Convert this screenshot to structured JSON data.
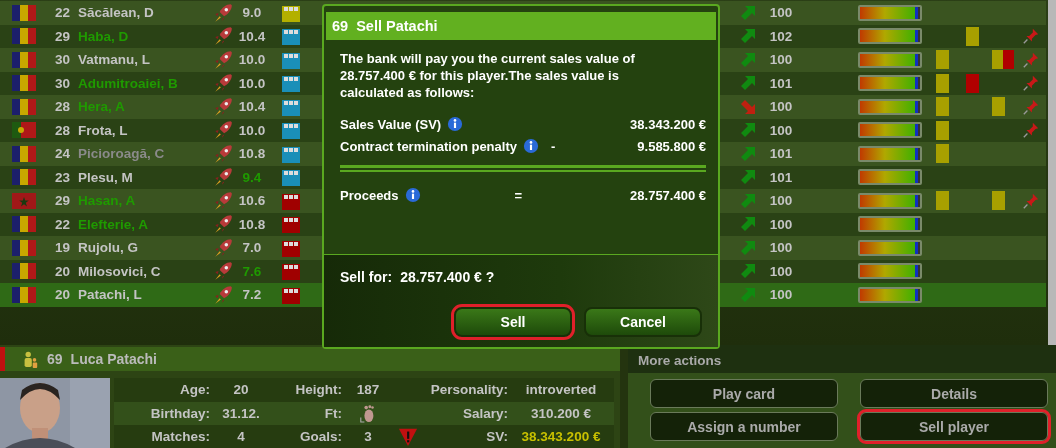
{
  "squad": {
    "rows": [
      {
        "flag": {
          "kind": "tricolor"
        },
        "number": "22",
        "name": "Săcălean, D",
        "in_lineup": false,
        "inactive": false,
        "rating": "9.0",
        "rating_good": false,
        "color": "#b3b000",
        "rising": true,
        "value": "100",
        "level": 0.97,
        "cards_1": [],
        "cards_2": [],
        "cards_3": [],
        "pinned": false,
        "selected": false
      },
      {
        "flag": {
          "kind": "tricolor"
        },
        "number": "29",
        "name": "Haba, D",
        "in_lineup": true,
        "inactive": false,
        "rating": "10.4",
        "rating_good": false,
        "color": "#1a8fb8",
        "rising": true,
        "value": "102",
        "level": 0.97,
        "cards_1": [],
        "cards_2": [
          {
            "color": "#a8a000"
          }
        ],
        "cards_3": [],
        "pinned": true,
        "selected": false
      },
      {
        "flag": {
          "kind": "tricolor"
        },
        "number": "30",
        "name": "Vatmanu, L",
        "in_lineup": false,
        "inactive": false,
        "rating": "10.0",
        "rating_good": false,
        "color": "#1a8fb8",
        "rising": true,
        "value": "100",
        "level": 0.97,
        "cards_1": [
          {
            "color": "#a8a000"
          }
        ],
        "cards_2": [],
        "cards_3": [
          {
            "color": "#a8a000"
          },
          {
            "color": "#b00000"
          }
        ],
        "pinned": true,
        "selected": false
      },
      {
        "flag": {
          "kind": "tricolor"
        },
        "number": "30",
        "name": "Adumitroaiei, B",
        "in_lineup": true,
        "inactive": false,
        "rating": "10.0",
        "rating_good": false,
        "color": "#1a8fb8",
        "rising": true,
        "value": "101",
        "level": 0.97,
        "cards_1": [
          {
            "color": "#a8a000"
          }
        ],
        "cards_2": [
          {
            "color": "#b00000"
          }
        ],
        "cards_3": [],
        "pinned": true,
        "selected": false
      },
      {
        "flag": {
          "kind": "tricolor"
        },
        "number": "28",
        "name": "Hera, A",
        "in_lineup": true,
        "inactive": false,
        "rating": "10.4",
        "rating_good": false,
        "color": "#1a8fb8",
        "rising": false,
        "value": "100",
        "level": 0.97,
        "cards_1": [
          {
            "color": "#a8a000"
          }
        ],
        "cards_2": [],
        "cards_3": [
          {
            "color": "#a8a000"
          }
        ],
        "pinned": true,
        "selected": false
      },
      {
        "flag": {
          "kind": "split"
        },
        "number": "28",
        "name": "Frota, L",
        "in_lineup": false,
        "inactive": false,
        "rating": "10.0",
        "rating_good": false,
        "color": "#1a8fb8",
        "rising": true,
        "value": "100",
        "level": 0.97,
        "cards_1": [
          {
            "color": "#a8a000"
          }
        ],
        "cards_2": [],
        "cards_3": [],
        "pinned": true,
        "selected": false
      },
      {
        "flag": {
          "kind": "tricolor"
        },
        "number": "24",
        "name": "Picioroagă, C",
        "in_lineup": false,
        "inactive": true,
        "rating": "10.8",
        "rating_good": false,
        "color": "#1a8fb8",
        "rising": true,
        "value": "101",
        "level": 0.97,
        "cards_1": [
          {
            "color": "#a8a000"
          }
        ],
        "cards_2": [],
        "cards_3": [],
        "pinned": false,
        "selected": false
      },
      {
        "flag": {
          "kind": "tricolor"
        },
        "number": "23",
        "name": "Plesu, M",
        "in_lineup": false,
        "inactive": false,
        "rating": "9.4",
        "rating_good": true,
        "color": "#1a8fb8",
        "rising": true,
        "value": "101",
        "level": 0.97,
        "cards_1": [],
        "cards_2": [],
        "cards_3": [],
        "pinned": false,
        "selected": false
      },
      {
        "flag": {
          "kind": "star"
        },
        "number": "29",
        "name": "Hasan, A",
        "in_lineup": true,
        "inactive": false,
        "rating": "10.6",
        "rating_good": false,
        "color": "#a00000",
        "rising": true,
        "value": "100",
        "level": 0.97,
        "cards_1": [
          {
            "color": "#a8a000"
          }
        ],
        "cards_2": [],
        "cards_3": [
          {
            "color": "#a8a000"
          }
        ],
        "pinned": true,
        "selected": false
      },
      {
        "flag": {
          "kind": "tricolor"
        },
        "number": "22",
        "name": "Elefterie, A",
        "in_lineup": true,
        "inactive": false,
        "rating": "10.8",
        "rating_good": false,
        "color": "#a00000",
        "rising": true,
        "value": "100",
        "level": 0.97,
        "cards_1": [],
        "cards_2": [],
        "cards_3": [],
        "pinned": false,
        "selected": false
      },
      {
        "flag": {
          "kind": "tricolor"
        },
        "number": "19",
        "name": "Rujolu, G",
        "in_lineup": false,
        "inactive": false,
        "rating": "7.0",
        "rating_good": false,
        "color": "#a00000",
        "rising": true,
        "value": "100",
        "level": 0.97,
        "cards_1": [],
        "cards_2": [],
        "cards_3": [],
        "pinned": false,
        "selected": false
      },
      {
        "flag": {
          "kind": "tricolor"
        },
        "number": "20",
        "name": "Milosovici, C",
        "in_lineup": false,
        "inactive": false,
        "rating": "7.6",
        "rating_good": true,
        "color": "#a00000",
        "rising": true,
        "value": "100",
        "level": 0.97,
        "cards_1": [],
        "cards_2": [],
        "cards_3": [],
        "pinned": false,
        "selected": false
      },
      {
        "flag": {
          "kind": "tricolor"
        },
        "number": "20",
        "name": "Patachi, L",
        "in_lineup": false,
        "inactive": false,
        "rating": "7.2",
        "rating_good": false,
        "color": "#a00000",
        "rising": true,
        "value": "100",
        "level": 0.97,
        "cards_1": [],
        "cards_2": [],
        "cards_3": [],
        "pinned": false,
        "selected": true
      }
    ]
  },
  "dialog": {
    "number": "69",
    "title": "Sell Patachi",
    "message": "The bank will pay you the current sales value of 28.757.400 € for this player.The sales value is calculated as follows:",
    "lines": [
      {
        "label": "Sales Value (SV)",
        "amount": "38.343.200 €"
      },
      {
        "label": "Contract termination penalty",
        "operator": "-",
        "amount": "9.585.800 €"
      }
    ],
    "total": {
      "label": "Proceeds",
      "operator": "=",
      "amount": "28.757.400 €"
    },
    "question_label": "Sell for:",
    "question_value": "28.757.400 € ?",
    "buttons": [
      {
        "label": "Sell",
        "highlighted": true
      },
      {
        "label": "Cancel",
        "highlighted": false
      }
    ]
  },
  "player": {
    "number": "69",
    "name": "Luca Patachi",
    "rows": [
      {
        "warning": false,
        "items": [
          {
            "label": "Age:",
            "kind": "text",
            "value": "20",
            "highlight": false
          },
          {
            "label": "Height:",
            "kind": "text",
            "value": "187",
            "highlight": false
          },
          {
            "label": "Personality:",
            "kind": "text",
            "value": "introverted",
            "highlight": false
          }
        ]
      },
      {
        "warning": false,
        "items": [
          {
            "label": "Birthday:",
            "kind": "text",
            "value": "31.12.",
            "highlight": false
          },
          {
            "label": "Ft:",
            "kind": "foot"
          },
          {
            "label": "Salary:",
            "kind": "text",
            "value": "310.200 €",
            "highlight": false
          }
        ]
      },
      {
        "warning": true,
        "items": [
          {
            "label": "Matches:",
            "kind": "text",
            "value": "4",
            "highlight": false
          },
          {
            "label": "Goals:",
            "kind": "text",
            "value": "3",
            "highlight": false
          },
          {
            "label": "SV:",
            "kind": "text",
            "value": "38.343.200 €",
            "highlight": true
          }
        ]
      }
    ]
  },
  "actions": {
    "title": "More actions",
    "buttons": [
      {
        "label": "Play card",
        "highlighted": false
      },
      {
        "label": "Details",
        "highlighted": false
      },
      {
        "label": "Assign a number",
        "highlighted": false
      },
      {
        "label": "Sell player",
        "highlighted": true
      }
    ]
  }
}
